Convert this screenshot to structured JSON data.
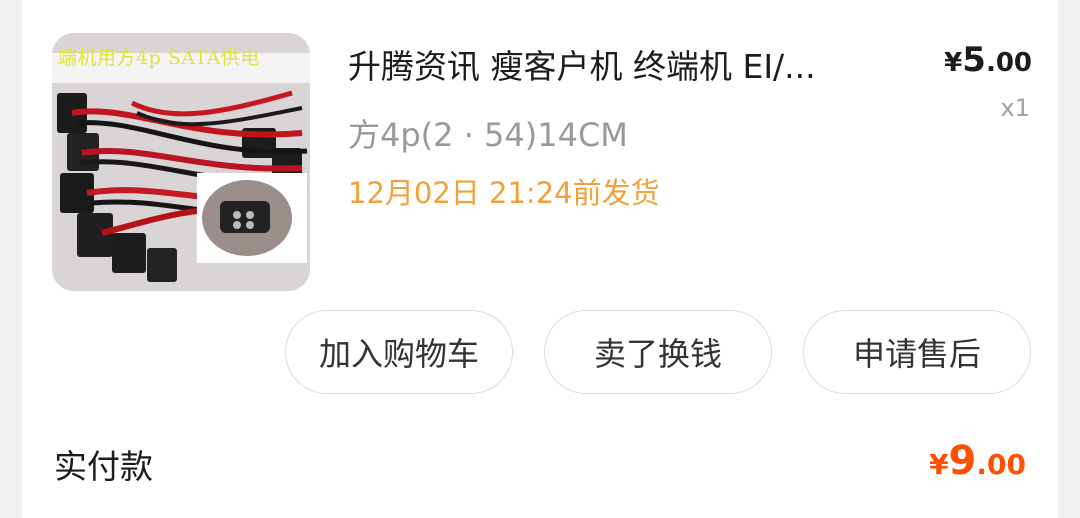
{
  "order_item": {
    "title": "升腾资讯 瘦客户机 终端机 EI/...",
    "spec": "方4p(2 · 54)14CM",
    "ship_time": "12月02日 21:24前发货",
    "price": {
      "symbol": "¥",
      "integer": "5",
      "decimal": ".00"
    },
    "quantity": "x1",
    "image_caption": "端机用方4p SATA供电",
    "image_icon": "product-thumbnail-icon"
  },
  "actions": {
    "add_to_cart": "加入购物车",
    "resell": "卖了换钱",
    "after_sales": "申请售后"
  },
  "payment": {
    "label": "实付款",
    "amount": {
      "symbol": "¥",
      "integer": "9",
      "decimal": ".00"
    }
  },
  "colors": {
    "accent": "#ff5000",
    "ship_text": "#f2a13a",
    "muted": "#999999"
  }
}
